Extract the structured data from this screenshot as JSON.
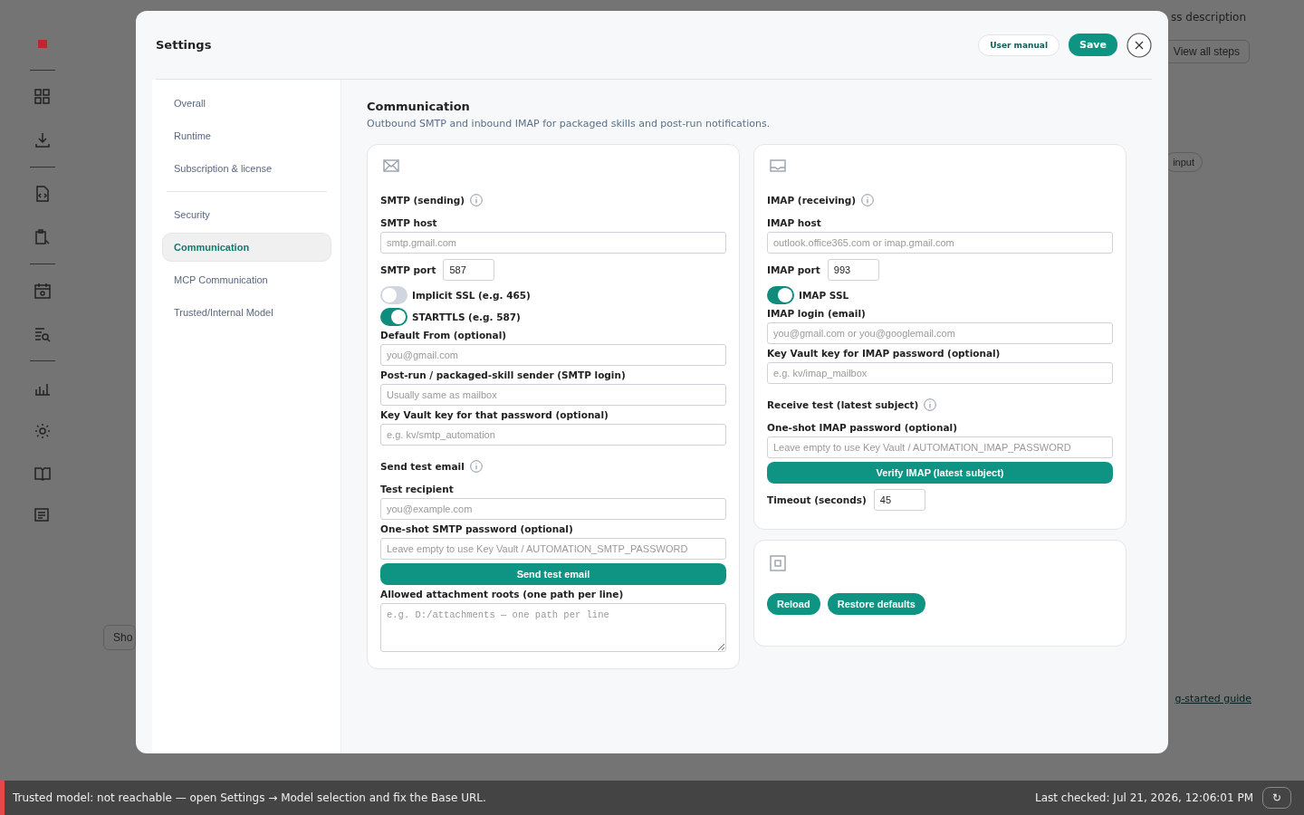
{
  "background": {
    "texts": [
      "ss description",
      "View all steps",
      "input",
      "Sho",
      "g-started guide"
    ]
  },
  "settings": {
    "title": "Settings",
    "actions": [
      {
        "label": "User manual",
        "kind": "outline"
      },
      {
        "label": "Save",
        "kind": "primary"
      }
    ],
    "nav": [
      {
        "label": "Overall",
        "selected": false,
        "divider_after": false
      },
      {
        "label": "Runtime",
        "selected": false,
        "divider_after": false
      },
      {
        "label": "Subscription & license",
        "selected": false,
        "divider_after": true
      },
      {
        "label": "Security",
        "selected": false,
        "divider_after": false
      },
      {
        "label": "Communication",
        "selected": true,
        "divider_after": false
      },
      {
        "label": "MCP Communication",
        "selected": false,
        "divider_after": false
      },
      {
        "label": "Trusted/Internal Model",
        "selected": false,
        "divider_after": false
      }
    ],
    "page_title": "Communication",
    "page_subtitle": "Outbound SMTP and inbound IMAP for packaged skills and post-run notifications.",
    "cards": [
      {
        "rows": [
          {
            "kind": "section",
            "label": "SMTP (sending)"
          },
          {
            "kind": "field",
            "label": "SMTP host",
            "placeholder": "smtp.gmail.com"
          },
          {
            "kind": "inline",
            "label": "SMTP port",
            "value": "587"
          },
          {
            "kind": "toggle",
            "label": "Implicit SSL (e.g. 465)",
            "on": false
          },
          {
            "kind": "toggle",
            "label": "STARTTLS (e.g. 587)",
            "on": true
          },
          {
            "kind": "field",
            "label": "Default From (optional)",
            "placeholder": "you@gmail.com"
          },
          {
            "kind": "field",
            "label": "Post-run / packaged-skill sender (SMTP login)",
            "placeholder": "Usually same as mailbox"
          },
          {
            "kind": "field",
            "label": "Key Vault key for that password (optional)",
            "placeholder": "e.g. kv/smtp_automation"
          },
          {
            "kind": "section",
            "label": "Send test email"
          },
          {
            "kind": "field",
            "label": "Test recipient",
            "placeholder": "you@example.com"
          },
          {
            "kind": "field",
            "label": "One-shot SMTP password (optional)",
            "placeholder": "Leave empty to use Key Vault / AUTOMATION_SMTP_PASSWORD"
          },
          {
            "kind": "button",
            "label": "Send test email"
          },
          {
            "kind": "textarea",
            "label": "Allowed attachment roots (one path per line)",
            "placeholder": "e.g. D:/attachments — one path per line"
          }
        ]
      },
      {
        "rows": [
          {
            "kind": "section",
            "label": "IMAP (receiving)"
          },
          {
            "kind": "field",
            "label": "IMAP host",
            "placeholder": "outlook.office365.com or imap.gmail.com"
          },
          {
            "kind": "inline",
            "label": "IMAP port",
            "value": "993"
          },
          {
            "kind": "toggle",
            "label": "IMAP SSL",
            "on": true
          },
          {
            "kind": "field",
            "label": "IMAP login (email)",
            "placeholder": "you@gmail.com or you@googlemail.com"
          },
          {
            "kind": "field",
            "label": "Key Vault key for IMAP password (optional)",
            "placeholder": "e.g. kv/imap_mailbox"
          },
          {
            "kind": "section",
            "label": "Receive test (latest subject)"
          },
          {
            "kind": "field",
            "label": "One-shot IMAP password (optional)",
            "placeholder": "Leave empty to use Key Vault / AUTOMATION_IMAP_PASSWORD"
          },
          {
            "kind": "button",
            "label": "Verify IMAP (latest subject)"
          },
          {
            "kind": "inline",
            "label": "Timeout (seconds)",
            "value": "45"
          }
        ]
      },
      {
        "rows": [
          {
            "kind": "buttons",
            "labels": [
              "Reload",
              "Restore defaults"
            ]
          }
        ]
      }
    ]
  },
  "status_bar": {
    "message": "Trusted model: not reachable — open Settings → Model selection and fix the Base URL.",
    "last_checked": "Last checked: Jul 21, 2026, 12:06:01 PM",
    "refresh": "↻"
  }
}
